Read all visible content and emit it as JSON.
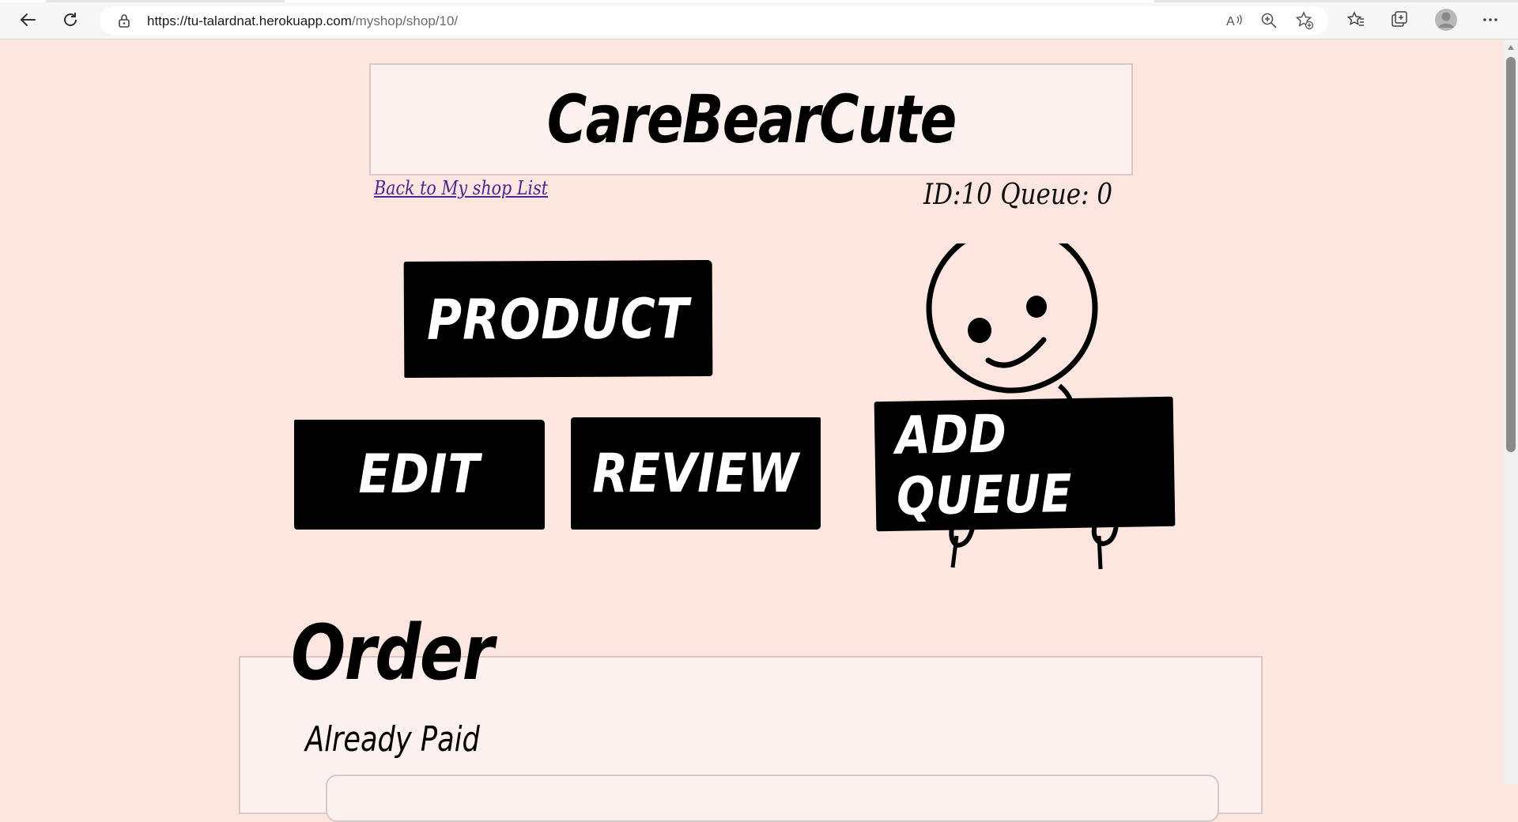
{
  "browser": {
    "url_host": "https://tu-talardnat.herokuapp.com",
    "url_path": "/myshop/shop/10/",
    "icons": [
      "back-icon",
      "refresh-icon",
      "lock-icon",
      "read-aloud-icon",
      "zoom-icon",
      "add-favorite-icon",
      "favorites-icon",
      "collections-icon",
      "profile-icon",
      "more-icon"
    ]
  },
  "header": {
    "shop_title": "CareBearCute",
    "back_link": "Back to My shop List",
    "id_label": "ID:10",
    "queue_label": "Queue: 0"
  },
  "actions": {
    "product": "PRODUCT",
    "edit": "EDIT",
    "review": "REVIEW",
    "add_queue": "ADD QUEUE"
  },
  "order": {
    "heading": "Order",
    "section": "Already Paid"
  },
  "colors": {
    "page_bg": "#fde5e0",
    "panel_bg": "#fdf1ef",
    "button_bg": "#000000",
    "link": "#4b2591"
  }
}
